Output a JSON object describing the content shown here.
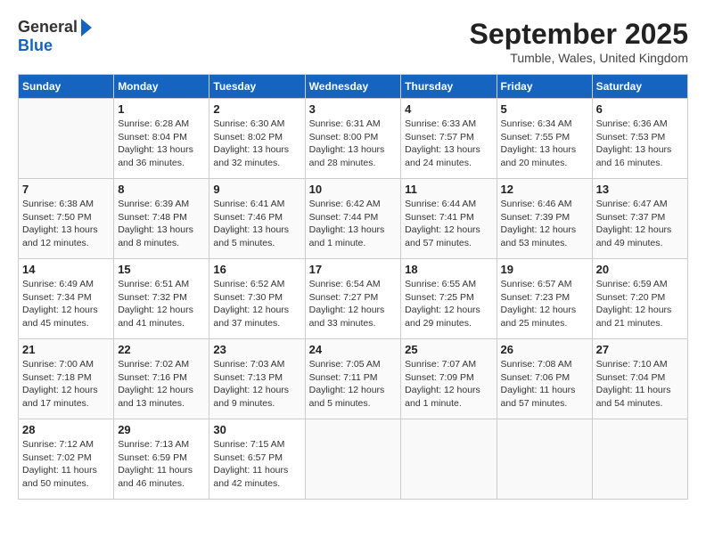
{
  "logo": {
    "general": "General",
    "blue": "Blue"
  },
  "title": "September 2025",
  "location": "Tumble, Wales, United Kingdom",
  "days_of_week": [
    "Sunday",
    "Monday",
    "Tuesday",
    "Wednesday",
    "Thursday",
    "Friday",
    "Saturday"
  ],
  "weeks": [
    [
      {
        "day": "",
        "detail": ""
      },
      {
        "day": "1",
        "detail": "Sunrise: 6:28 AM\nSunset: 8:04 PM\nDaylight: 13 hours\nand 36 minutes."
      },
      {
        "day": "2",
        "detail": "Sunrise: 6:30 AM\nSunset: 8:02 PM\nDaylight: 13 hours\nand 32 minutes."
      },
      {
        "day": "3",
        "detail": "Sunrise: 6:31 AM\nSunset: 8:00 PM\nDaylight: 13 hours\nand 28 minutes."
      },
      {
        "day": "4",
        "detail": "Sunrise: 6:33 AM\nSunset: 7:57 PM\nDaylight: 13 hours\nand 24 minutes."
      },
      {
        "day": "5",
        "detail": "Sunrise: 6:34 AM\nSunset: 7:55 PM\nDaylight: 13 hours\nand 20 minutes."
      },
      {
        "day": "6",
        "detail": "Sunrise: 6:36 AM\nSunset: 7:53 PM\nDaylight: 13 hours\nand 16 minutes."
      }
    ],
    [
      {
        "day": "7",
        "detail": "Sunrise: 6:38 AM\nSunset: 7:50 PM\nDaylight: 13 hours\nand 12 minutes."
      },
      {
        "day": "8",
        "detail": "Sunrise: 6:39 AM\nSunset: 7:48 PM\nDaylight: 13 hours\nand 8 minutes."
      },
      {
        "day": "9",
        "detail": "Sunrise: 6:41 AM\nSunset: 7:46 PM\nDaylight: 13 hours\nand 5 minutes."
      },
      {
        "day": "10",
        "detail": "Sunrise: 6:42 AM\nSunset: 7:44 PM\nDaylight: 13 hours\nand 1 minute."
      },
      {
        "day": "11",
        "detail": "Sunrise: 6:44 AM\nSunset: 7:41 PM\nDaylight: 12 hours\nand 57 minutes."
      },
      {
        "day": "12",
        "detail": "Sunrise: 6:46 AM\nSunset: 7:39 PM\nDaylight: 12 hours\nand 53 minutes."
      },
      {
        "day": "13",
        "detail": "Sunrise: 6:47 AM\nSunset: 7:37 PM\nDaylight: 12 hours\nand 49 minutes."
      }
    ],
    [
      {
        "day": "14",
        "detail": "Sunrise: 6:49 AM\nSunset: 7:34 PM\nDaylight: 12 hours\nand 45 minutes."
      },
      {
        "day": "15",
        "detail": "Sunrise: 6:51 AM\nSunset: 7:32 PM\nDaylight: 12 hours\nand 41 minutes."
      },
      {
        "day": "16",
        "detail": "Sunrise: 6:52 AM\nSunset: 7:30 PM\nDaylight: 12 hours\nand 37 minutes."
      },
      {
        "day": "17",
        "detail": "Sunrise: 6:54 AM\nSunset: 7:27 PM\nDaylight: 12 hours\nand 33 minutes."
      },
      {
        "day": "18",
        "detail": "Sunrise: 6:55 AM\nSunset: 7:25 PM\nDaylight: 12 hours\nand 29 minutes."
      },
      {
        "day": "19",
        "detail": "Sunrise: 6:57 AM\nSunset: 7:23 PM\nDaylight: 12 hours\nand 25 minutes."
      },
      {
        "day": "20",
        "detail": "Sunrise: 6:59 AM\nSunset: 7:20 PM\nDaylight: 12 hours\nand 21 minutes."
      }
    ],
    [
      {
        "day": "21",
        "detail": "Sunrise: 7:00 AM\nSunset: 7:18 PM\nDaylight: 12 hours\nand 17 minutes."
      },
      {
        "day": "22",
        "detail": "Sunrise: 7:02 AM\nSunset: 7:16 PM\nDaylight: 12 hours\nand 13 minutes."
      },
      {
        "day": "23",
        "detail": "Sunrise: 7:03 AM\nSunset: 7:13 PM\nDaylight: 12 hours\nand 9 minutes."
      },
      {
        "day": "24",
        "detail": "Sunrise: 7:05 AM\nSunset: 7:11 PM\nDaylight: 12 hours\nand 5 minutes."
      },
      {
        "day": "25",
        "detail": "Sunrise: 7:07 AM\nSunset: 7:09 PM\nDaylight: 12 hours\nand 1 minute."
      },
      {
        "day": "26",
        "detail": "Sunrise: 7:08 AM\nSunset: 7:06 PM\nDaylight: 11 hours\nand 57 minutes."
      },
      {
        "day": "27",
        "detail": "Sunrise: 7:10 AM\nSunset: 7:04 PM\nDaylight: 11 hours\nand 54 minutes."
      }
    ],
    [
      {
        "day": "28",
        "detail": "Sunrise: 7:12 AM\nSunset: 7:02 PM\nDaylight: 11 hours\nand 50 minutes."
      },
      {
        "day": "29",
        "detail": "Sunrise: 7:13 AM\nSunset: 6:59 PM\nDaylight: 11 hours\nand 46 minutes."
      },
      {
        "day": "30",
        "detail": "Sunrise: 7:15 AM\nSunset: 6:57 PM\nDaylight: 11 hours\nand 42 minutes."
      },
      {
        "day": "",
        "detail": ""
      },
      {
        "day": "",
        "detail": ""
      },
      {
        "day": "",
        "detail": ""
      },
      {
        "day": "",
        "detail": ""
      }
    ]
  ]
}
